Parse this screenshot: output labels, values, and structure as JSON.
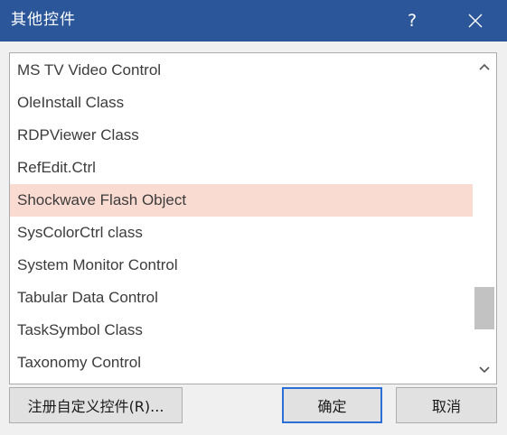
{
  "window": {
    "title": "其他控件",
    "help_label": "?"
  },
  "icons": {
    "close": "close-icon",
    "scroll_up": "chevron-up-icon",
    "scroll_down": "chevron-down-icon"
  },
  "list": {
    "selected_index": 4,
    "items": [
      "MS TV Video Control",
      "OleInstall Class",
      "RDPViewer Class",
      "RefEdit.Ctrl",
      "Shockwave Flash Object",
      "SysColorCtrl class",
      "System Monitor Control",
      "Tabular Data Control",
      "TaskSymbol Class",
      "Taxonomy Control"
    ]
  },
  "scrollbar": {
    "position_fraction": 0.88,
    "visible_fraction": 0.15
  },
  "buttons": {
    "register_label": "注册自定义控件(R)...",
    "ok_label": "确定",
    "cancel_label": "取消"
  },
  "colors": {
    "titlebar": "#2b579a",
    "selected_row": "#fadbd2",
    "default_button_border": "#2b6fd6"
  }
}
